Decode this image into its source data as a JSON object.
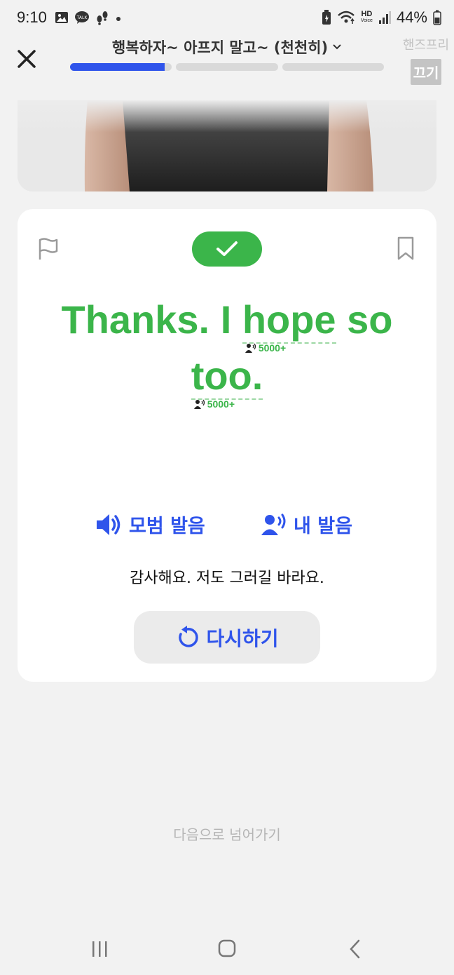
{
  "status_bar": {
    "time": "9:10",
    "left_icons": [
      "gallery-icon",
      "kakaotalk-icon",
      "steps-icon",
      "dot-icon"
    ],
    "right_icons": [
      "battery-saver-icon",
      "wifi-icon",
      "hd-voice-icon",
      "signal-icon",
      "battery-icon"
    ],
    "hd_label": "HD",
    "voice_label": "Voice",
    "battery": "44%"
  },
  "header": {
    "title": "행복하자~ 아프지 말고~ (천천히)",
    "progress": {
      "segments": 3,
      "current": 1,
      "fill_of_current": 0.93
    },
    "handsfree_label": "핸즈프리",
    "handsfree_toggle": "끄기"
  },
  "card": {
    "result": "correct",
    "sentence_line1": [
      "Thanks.",
      "I",
      "hope",
      "so"
    ],
    "sentence_line2": [
      "too."
    ],
    "tracked_words": [
      {
        "word": "hope",
        "count": "5000+"
      },
      {
        "word": "too.",
        "count": "5000+"
      }
    ],
    "model_pronunciation_label": "모범 발음",
    "my_pronunciation_label": "내 발음",
    "translation": "감사해요. 저도 그러길 바라요.",
    "retry_label": "다시하기"
  },
  "next_label": "다음으로 넘어가기",
  "colors": {
    "accent_blue": "#2f54eb",
    "success_green": "#3bb54a",
    "background": "#f2f2f2"
  }
}
